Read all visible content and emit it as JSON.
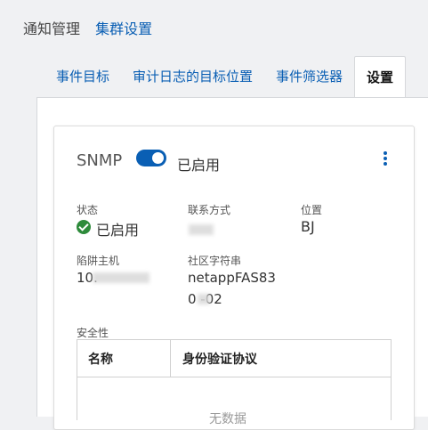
{
  "breadcrumb": {
    "root": "通知管理",
    "current": "集群设置"
  },
  "tabs": [
    {
      "label": "事件目标"
    },
    {
      "label": "审计日志的目标位置"
    },
    {
      "label": "事件筛选器"
    },
    {
      "label": "设置"
    }
  ],
  "snmp": {
    "title": "SNMP",
    "toggle_state": "on",
    "toggle_label": "已启用",
    "fields": {
      "status_label": "状态",
      "status_value": "已启用",
      "contact_label": "联系方式",
      "contact_value": "",
      "location_label": "位置",
      "location_value": "BJ",
      "trap_host_label": "陷阱主机",
      "trap_host_value": "10.",
      "community_label": "社区字符串",
      "community_value_line1": "netappFAS83",
      "community_value_line2": "0 -02"
    },
    "security": {
      "section_label": "安全性",
      "columns": [
        "名称",
        "身份验证协议"
      ],
      "empty_text": "无数据"
    }
  },
  "colors": {
    "accent": "#0a5fb4",
    "success": "#2e8b3b"
  }
}
